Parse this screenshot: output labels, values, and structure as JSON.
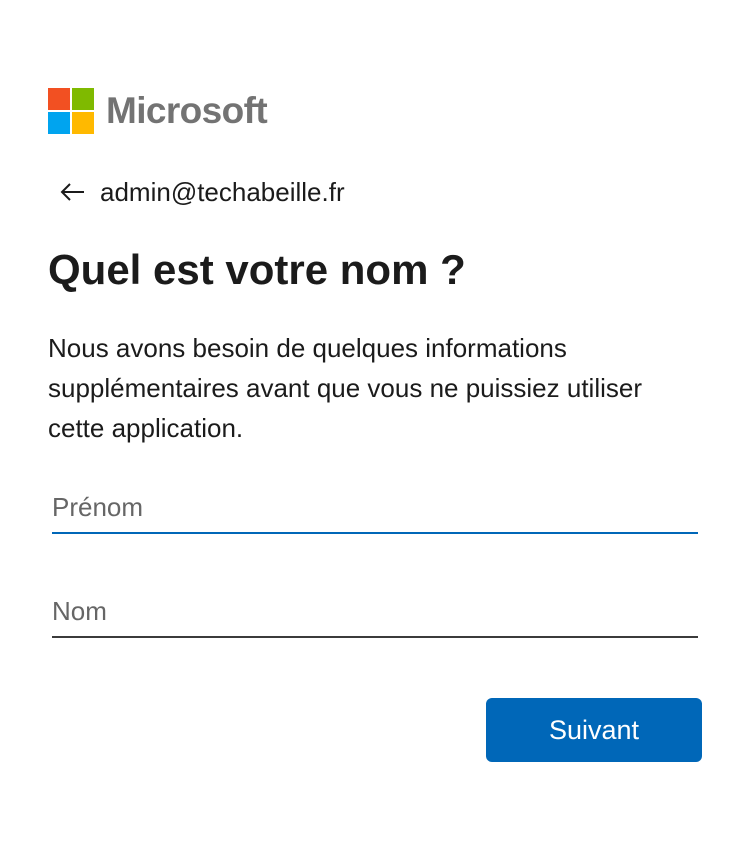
{
  "brand": {
    "name": "Microsoft",
    "logo_colors": [
      "#f25022",
      "#7fba00",
      "#00a4ef",
      "#ffb900"
    ]
  },
  "identity": {
    "back_icon": "arrow-left-icon",
    "email": "admin@techabeille.fr"
  },
  "page": {
    "title": "Quel est votre nom ?",
    "description": "Nous avons besoin de quelques informations supplémentaires avant que vous ne puissiez utiliser cette application."
  },
  "form": {
    "first_name": {
      "value": "",
      "placeholder": "Prénom"
    },
    "last_name": {
      "value": "",
      "placeholder": "Nom"
    },
    "submit_label": "Suivant"
  },
  "colors": {
    "accent": "#0067b8",
    "text": "#1b1b1b",
    "brand_text": "#737373"
  }
}
